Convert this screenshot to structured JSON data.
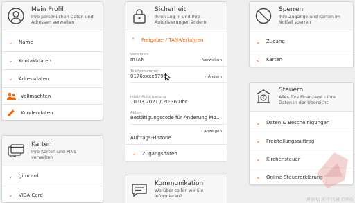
{
  "profil": {
    "title": "Mein Profil",
    "subtitle": "Ihre persönlichen Daten und Adressen verwalten",
    "items": [
      "Name",
      "Kontaktdaten",
      "Adressdaten",
      "Vollmachten",
      "Kundendaten"
    ]
  },
  "karten": {
    "title": "Karten",
    "subtitle": "Ihre Karten und PINs verwalten",
    "items": [
      "girocard",
      "VISA Card"
    ]
  },
  "sicherheit": {
    "title": "Sicherheit",
    "subtitle": "Ihren Log-in und Ihre Autorisierungen ändern",
    "section_title": "Freigabe- / TAN-Verfahren",
    "verfahren_label": "Verfahren",
    "verfahren_value": "mTAN",
    "verfahren_action": "Verwalten",
    "telefon_label": "Telefonnummer",
    "telefon_value": "0176xxxx6795",
    "telefon_action": "Ändern",
    "letzte_label": "letzte Autorisierung",
    "letzte_value": "10.03.2021 / 20:36 Uhr",
    "aktion_label": "Aktion",
    "aktion_value": "Bestätigungscode für Änderung Mobilfunk...",
    "historie_label": "Auftrags-Historie",
    "historie_action": "Anzeigen",
    "zugangsdaten": "Zugangsdaten"
  },
  "kommunikation": {
    "title": "Kommunikation",
    "subtitle": "Worüber sollen wir Sie informieren?"
  },
  "sperren": {
    "title": "Sperren",
    "subtitle": "Ihre Zugänge und Karten im Notfall sperren",
    "items": [
      "Zugang",
      "Karten"
    ]
  },
  "steuern": {
    "title": "Steuern",
    "subtitle": "Alles fürs Finanzamt - Ihre Daten in der Übersicht",
    "items": [
      "Daten & Bescheinigungen",
      "Freistellungsauftrag",
      "Kirchensteuer",
      "Online-Steuererklärung"
    ]
  },
  "watermark": "WWW.K-FISH.ORG",
  "colors": {
    "accent": "#ff6200",
    "text": "#333333",
    "background": "#eeeeee"
  }
}
